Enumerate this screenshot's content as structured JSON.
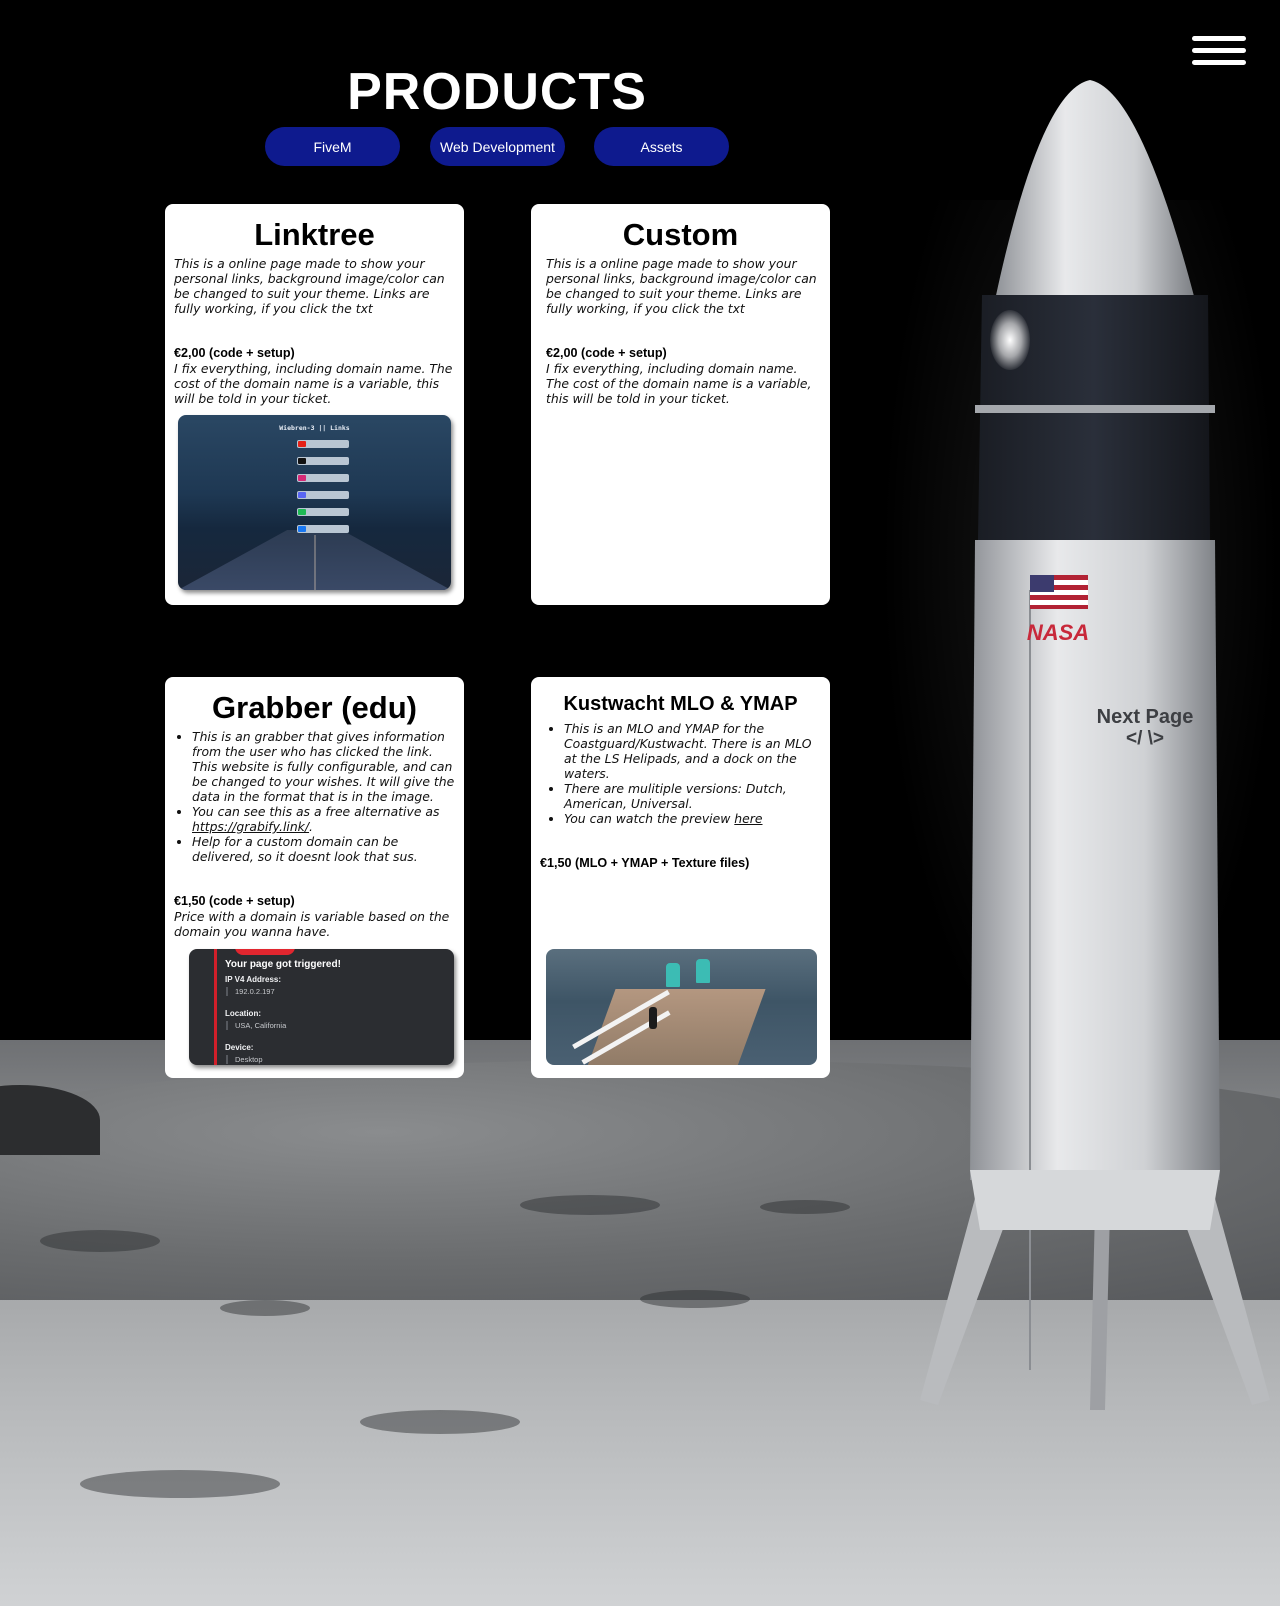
{
  "header": {
    "title": "PRODUCTS",
    "menu_icon": "hamburger-menu-icon"
  },
  "tabs": [
    {
      "label": "FiveM"
    },
    {
      "label": "Web Development"
    },
    {
      "label": "Assets"
    }
  ],
  "products": {
    "linktree": {
      "title": "Linktree",
      "description": "This is a online page made to show your personal links, background image/color can be changed to suit your theme. Links are fully working, if you click the txt",
      "price": "€2,00 (code + setup)",
      "price_note": "I fix everything, including domain name. The cost of the domain name is a variable, this will be told in your ticket.",
      "preview": {
        "heading": "Wiebren-3 || Links"
      }
    },
    "custom": {
      "title": "Custom",
      "description": "This is a online page made to show your personal links, background image/color can be changed to suit your theme. Links are fully working, if you click the txt",
      "price": "€2,00 (code + setup)",
      "price_note": "I fix everything, including domain name. The cost of the domain name is a variable, this will be told in your ticket."
    },
    "grabber": {
      "title": "Grabber (edu)",
      "bullets": {
        "b1": "This is an grabber that gives information from the user who has clicked the link. This website is fully configurable, and can be changed to your wishes. It will give the data in the format that is in the image.",
        "b2_prefix": "You can see this as a free alternative as ",
        "b2_link": "https://grabify.link/",
        "b2_suffix": ".",
        "b3": "Help for a custom domain can be delivered, so it doesnt look that sus."
      },
      "price": "€1,50 (code + setup)",
      "price_note": "Price with a domain is variable based on the domain you wanna have.",
      "preview": {
        "heading": "Your page got triggered!",
        "ip_label": "IP V4 Address:",
        "ip_value": "192.0.2.197",
        "location_label": "Location:",
        "location_value": "USA, California",
        "device_label": "Device:",
        "device_value": "Desktop"
      }
    },
    "kustwacht": {
      "title": "Kustwacht MLO & YMAP",
      "bullets": {
        "b1": "This is an MLO and YMAP for the Coastguard/Kustwacht. There is an MLO at the LS Helipads, and a dock on the waters.",
        "b2": "There are mulitiple versions: Dutch, American, Universal.",
        "b3_prefix": "You can watch the preview ",
        "b3_link": "here"
      },
      "price": "€1,50 (MLO + YMAP + Texture files)"
    }
  },
  "next_page": {
    "label": "Next Page",
    "code": "</ \\>"
  },
  "colors": {
    "tab_bg": "#0e1a8e",
    "card_bg": "#ffffff",
    "page_bg": "#000000"
  }
}
